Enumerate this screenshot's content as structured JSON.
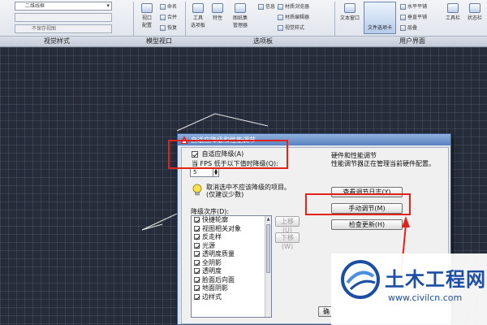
{
  "ribbon": {
    "panel_labels": {
      "viewport_styles": "视觉样式",
      "model_viewport": "模型视口",
      "palettes": "选项板",
      "user_interface": "用户界面"
    },
    "visual_style_combo": "二维线框",
    "view_combo": "",
    "unsaved_combo": "不保存视图",
    "buttons": {
      "viewport_config": "视口\n配置",
      "named": "命名",
      "join": "合并",
      "restore": "恢复",
      "tool_palettes": "工具\n选项板",
      "properties": "特性",
      "sheet_set": "图纸集\n管理器",
      "info": "信息",
      "material_browser": "材质浏览器",
      "material_editor": "材质编辑器",
      "visual_style": "视觉样式",
      "text_window": "文本窗口",
      "file_tabs": "文件选项卡",
      "horizontal_tile": "水平平铺",
      "vertical_tile": "垂直平铺",
      "cascade": "层叠",
      "toolbar": "工具栏",
      "status_bar": "状态栏"
    }
  },
  "dialog": {
    "title": "自适应降级和性能调节",
    "adaptive_degradation_label": "自适应降级(A)",
    "adaptive_degradation_checked": true,
    "fps_label": "当 FPS 低于以下值时降级(Q):",
    "fps_value": "5",
    "tip_text": "取消选中不应该降级的项目。(仅建议少数)",
    "order_label": "降级次序(D):",
    "order_items": [
      {
        "label": "快捷轮廓",
        "checked": true
      },
      {
        "label": "视图相关对象",
        "checked": true
      },
      {
        "label": "反走样",
        "checked": true
      },
      {
        "label": "光源",
        "checked": true
      },
      {
        "label": "透明度质量",
        "checked": true
      },
      {
        "label": "全阴影",
        "checked": true
      },
      {
        "label": "透明度",
        "checked": true
      },
      {
        "label": "脸面后向面",
        "checked": true
      },
      {
        "label": "地面阴影",
        "checked": true
      },
      {
        "label": "边样式",
        "checked": true
      }
    ],
    "move_up": "上移(U)",
    "move_down": "下移(W)",
    "hardware_title": "硬件和性能调节",
    "hardware_desc": "性能调节器正在管理当前硬件配置。",
    "view_log": "查看调节日志(Y)",
    "manual_tune": "手动调节(M)",
    "check_updates": "检查更新(H)",
    "ok_partial": "确"
  },
  "watermark": {
    "text": "土木工程网",
    "url": "www.civilcn.com"
  },
  "colors": {
    "canvas_bg": "#262c3a",
    "highlight": "#e2231a",
    "watermark_blue": "#1c4ea3"
  }
}
